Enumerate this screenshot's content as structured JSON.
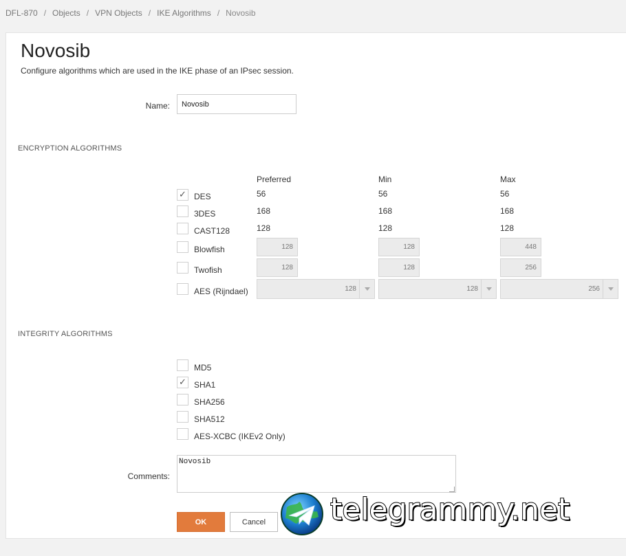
{
  "breadcrumb": {
    "items": [
      "DFL-870",
      "Objects",
      "VPN Objects",
      "IKE Algorithms"
    ],
    "current": "Novosib",
    "separator": "/"
  },
  "page": {
    "title": "Novosib",
    "description": "Configure algorithms which are used in the IKE phase of an IPsec session."
  },
  "name_field": {
    "label": "Name:",
    "value": "Novosib"
  },
  "encryption": {
    "section_title": "ENCRYPTION ALGORITHMS",
    "columns": {
      "preferred": "Preferred",
      "min": "Min",
      "max": "Max"
    },
    "rows": [
      {
        "label": "DES",
        "checked": true,
        "preferred": "56",
        "min": "56",
        "max": "56"
      },
      {
        "label": "3DES",
        "checked": false,
        "preferred": "168",
        "min": "168",
        "max": "168"
      },
      {
        "label": "CAST128",
        "checked": false,
        "preferred": "128",
        "min": "128",
        "max": "128"
      },
      {
        "label": "Blowfish",
        "checked": false,
        "preferred": "128",
        "min": "128",
        "max": "448"
      },
      {
        "label": "Twofish",
        "checked": false,
        "preferred": "128",
        "min": "128",
        "max": "256"
      },
      {
        "label": "AES (Rijndael)",
        "checked": false,
        "preferred": "128",
        "min": "128",
        "max": "256"
      }
    ]
  },
  "integrity": {
    "section_title": "INTEGRITY ALGORITHMS",
    "items": [
      {
        "label": "MD5",
        "checked": false
      },
      {
        "label": "SHA1",
        "checked": true
      },
      {
        "label": "SHA256",
        "checked": false
      },
      {
        "label": "SHA512",
        "checked": false
      },
      {
        "label": "AES-XCBC (IKEv2 Only)",
        "checked": false
      }
    ]
  },
  "comments": {
    "label": "Comments:",
    "value": "Novosib"
  },
  "buttons": {
    "ok": "OK",
    "cancel": "Cancel"
  },
  "icons": {
    "check": "check-icon",
    "dropdown": "chevron-down-icon",
    "watermark_logo": "telegram-globe-icon"
  },
  "colors": {
    "accent": "#e27b3c",
    "panel_bg": "#ffffff",
    "page_bg": "#f2f2f2"
  },
  "watermark": {
    "text": "telegrammy.net"
  }
}
